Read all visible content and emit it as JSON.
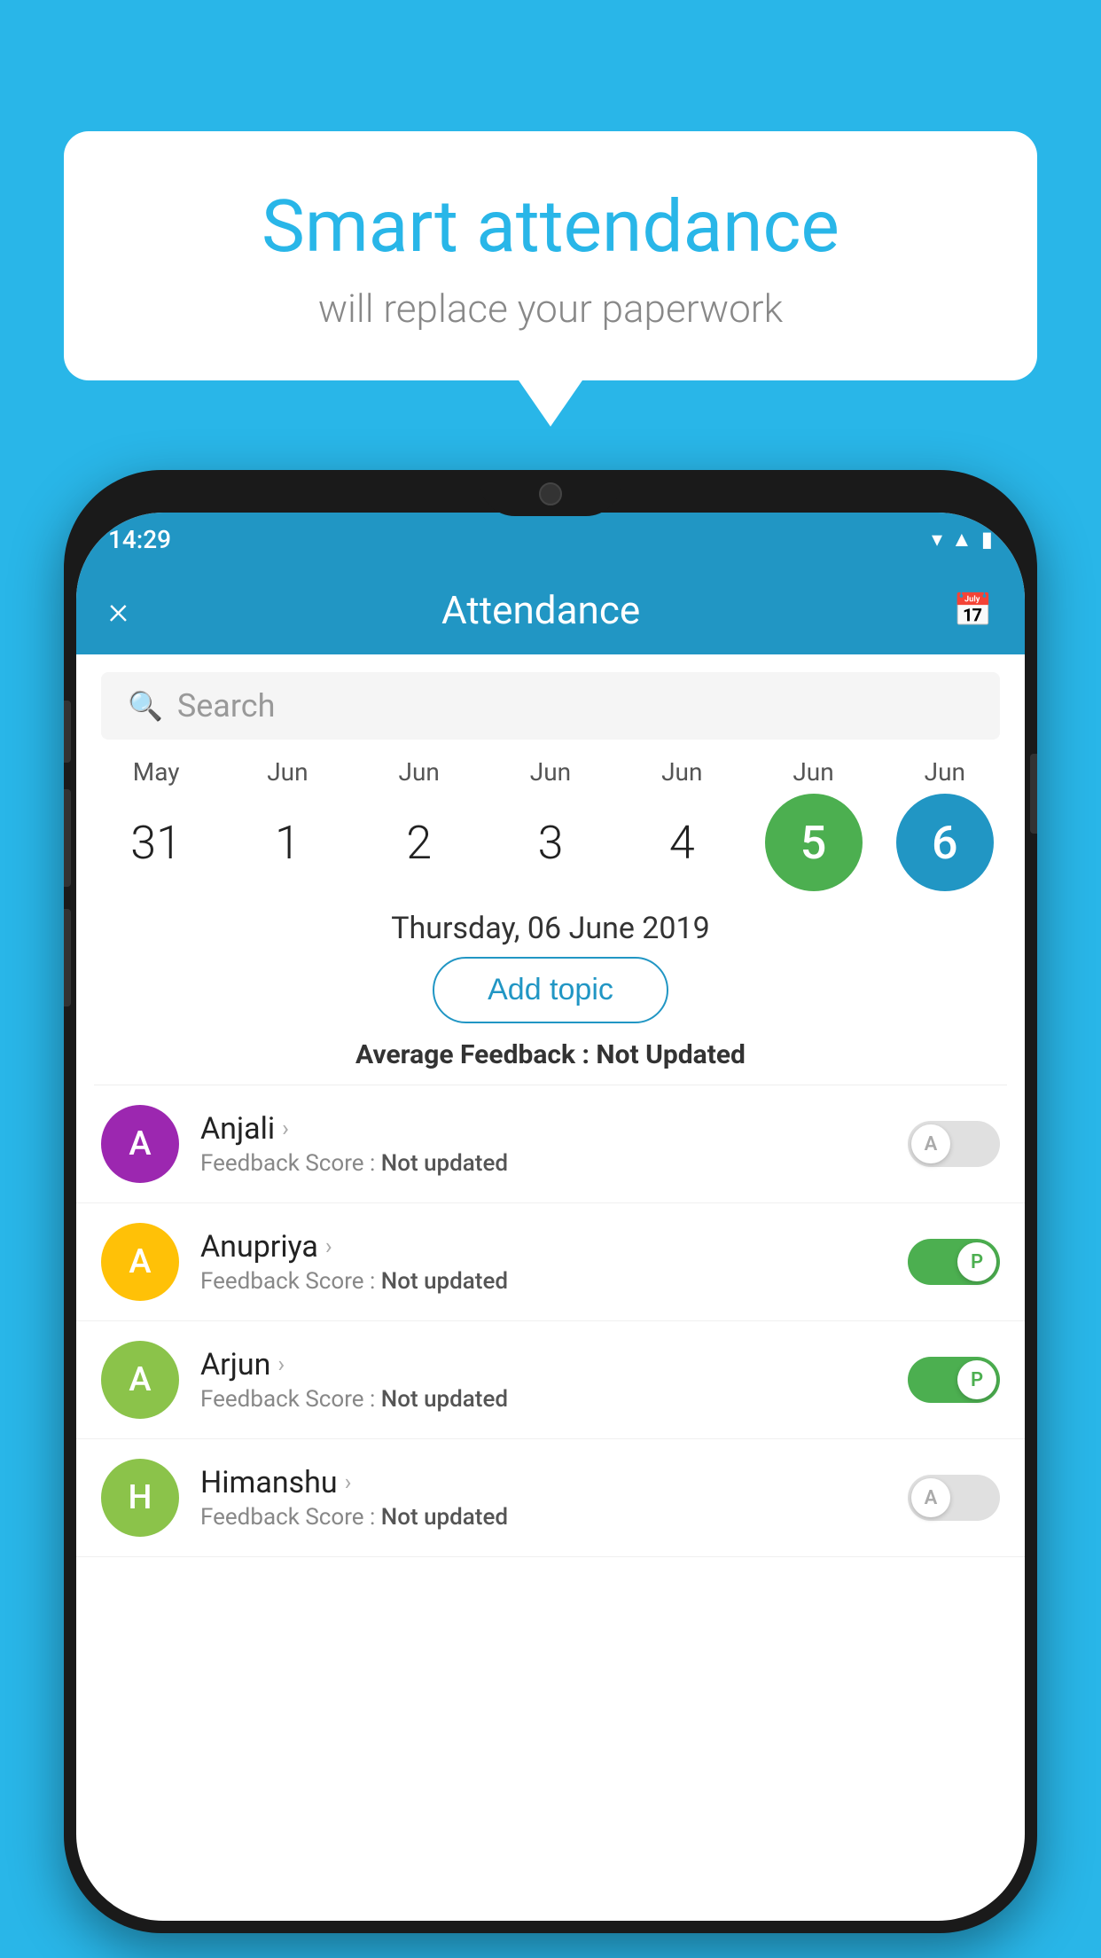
{
  "background_color": "#29b6e8",
  "bubble": {
    "title": "Smart attendance",
    "subtitle": "will replace your paperwork"
  },
  "status_bar": {
    "time": "14:29",
    "icons": [
      "wifi",
      "signal",
      "battery"
    ]
  },
  "header": {
    "title": "Attendance",
    "close_label": "×",
    "calendar_icon": "📅"
  },
  "search": {
    "placeholder": "Search"
  },
  "dates": [
    {
      "month": "May",
      "day": "31",
      "style": "normal"
    },
    {
      "month": "Jun",
      "day": "1",
      "style": "normal"
    },
    {
      "month": "Jun",
      "day": "2",
      "style": "normal"
    },
    {
      "month": "Jun",
      "day": "3",
      "style": "normal"
    },
    {
      "month": "Jun",
      "day": "4",
      "style": "normal"
    },
    {
      "month": "Jun",
      "day": "5",
      "style": "green"
    },
    {
      "month": "Jun",
      "day": "6",
      "style": "blue"
    }
  ],
  "selected_date_label": "Thursday, 06 June 2019",
  "add_topic_label": "Add topic",
  "avg_feedback_label": "Average Feedback :",
  "avg_feedback_value": "Not Updated",
  "students": [
    {
      "name": "Anjali",
      "feedback_label": "Feedback Score :",
      "feedback_value": "Not updated",
      "avatar_letter": "A",
      "avatar_color": "#9c27b0",
      "toggle_state": "off",
      "toggle_letter": "A"
    },
    {
      "name": "Anupriya",
      "feedback_label": "Feedback Score :",
      "feedback_value": "Not updated",
      "avatar_letter": "A",
      "avatar_color": "#ffc107",
      "toggle_state": "on",
      "toggle_letter": "P"
    },
    {
      "name": "Arjun",
      "feedback_label": "Feedback Score :",
      "feedback_value": "Not updated",
      "avatar_letter": "A",
      "avatar_color": "#8bc34a",
      "toggle_state": "on",
      "toggle_letter": "P"
    },
    {
      "name": "Himanshu",
      "feedback_label": "Feedback Score :",
      "feedback_value": "Not updated",
      "avatar_letter": "H",
      "avatar_color": "#8bc34a",
      "toggle_state": "off",
      "toggle_letter": "A"
    }
  ]
}
